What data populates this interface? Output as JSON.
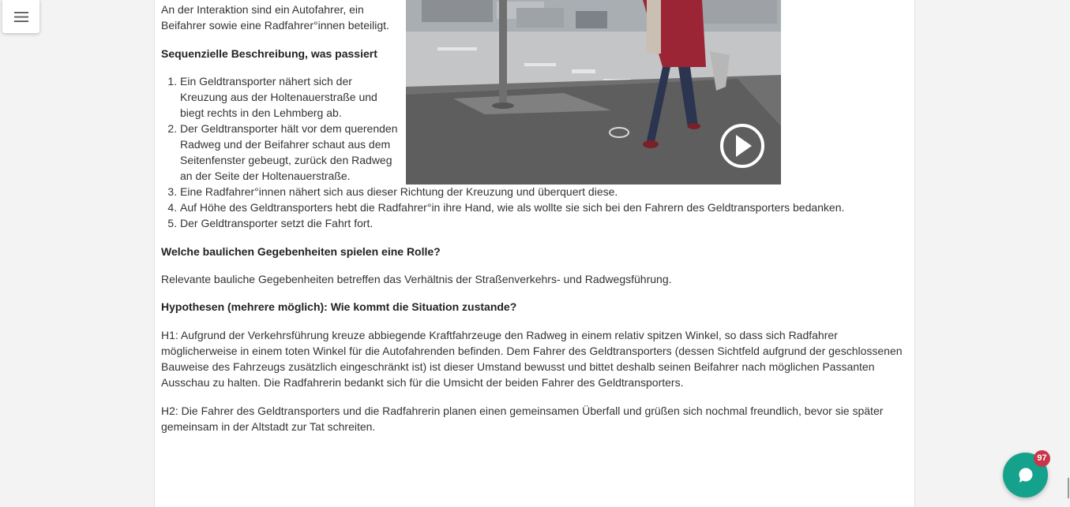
{
  "intro": "An der Interaktion sind ein Autofahrer, ein Beifahrer sowie eine Radfahrer°innen beteiligt.",
  "headings": {
    "sequence": "Sequenzielle Beschreibung, was passiert",
    "structural": "Welche baulichen Gegebenheiten spielen eine Rolle?",
    "hypotheses": "Hypothesen (mehrere möglich): Wie kommt die Situation zustande?"
  },
  "steps": [
    "Ein Geldtransporter nähert sich der Kreuzung aus der Holtenauerstraße und biegt rechts in den Lehmberg ab.",
    "Der Geldtransporter hält vor dem querenden Radweg und der Beifahrer schaut aus dem Seitenfenster gebeugt, zurück den Radweg an der Seite der Holtenauerstraße.",
    "Eine Radfahrer°innen nähert sich aus dieser Richtung der Kreuzung und überquert diese.",
    "Auf Höhe des Geldtransporters hebt die Radfahrer°in ihre Hand, wie als wollte sie sich bei den Fahrern des Geldtransporters bedanken.",
    "Der Geldtransporter setzt die Fahrt fort."
  ],
  "structural_text": "Relevante bauliche Gegebenheiten betreffen das Verhältnis der Straßenverkehrs- und Radwegsführung.",
  "h1": "H1: Aufgrund der Verkehrsführung kreuze abbiegende Kraftfahrzeuge den Radweg in einem relativ spitzen Winkel, so dass sich Radfahrer möglicherweise in einem toten Winkel für die Autofahrenden befinden. Dem Fahrer des Geldtransporters (dessen Sichtfeld aufgrund der geschlossenen Bauweise des Fahrzeugs zusätzlich eingeschränkt ist) ist dieser Umstand bewusst und bittet deshalb seinen Beifahrer nach möglichen Passanten Ausschau zu halten. Die Radfahrerin bedankt sich für die Umsicht der beiden Fahrer des Geldtransporters.",
  "h2": "H2: Die Fahrer des Geldtransporters und die Radfahrerin planen einen gemeinsamen Überfall und grüßen sich nochmal freundlich, bevor sie später gemeinsam in der Altstadt zur Tat schreiten.",
  "chat": {
    "badge": "97"
  },
  "colors": {
    "accent": "#15a28c",
    "badge": "#c9364a"
  },
  "icons": [
    "menu-icon",
    "play-icon",
    "chat-icon"
  ]
}
